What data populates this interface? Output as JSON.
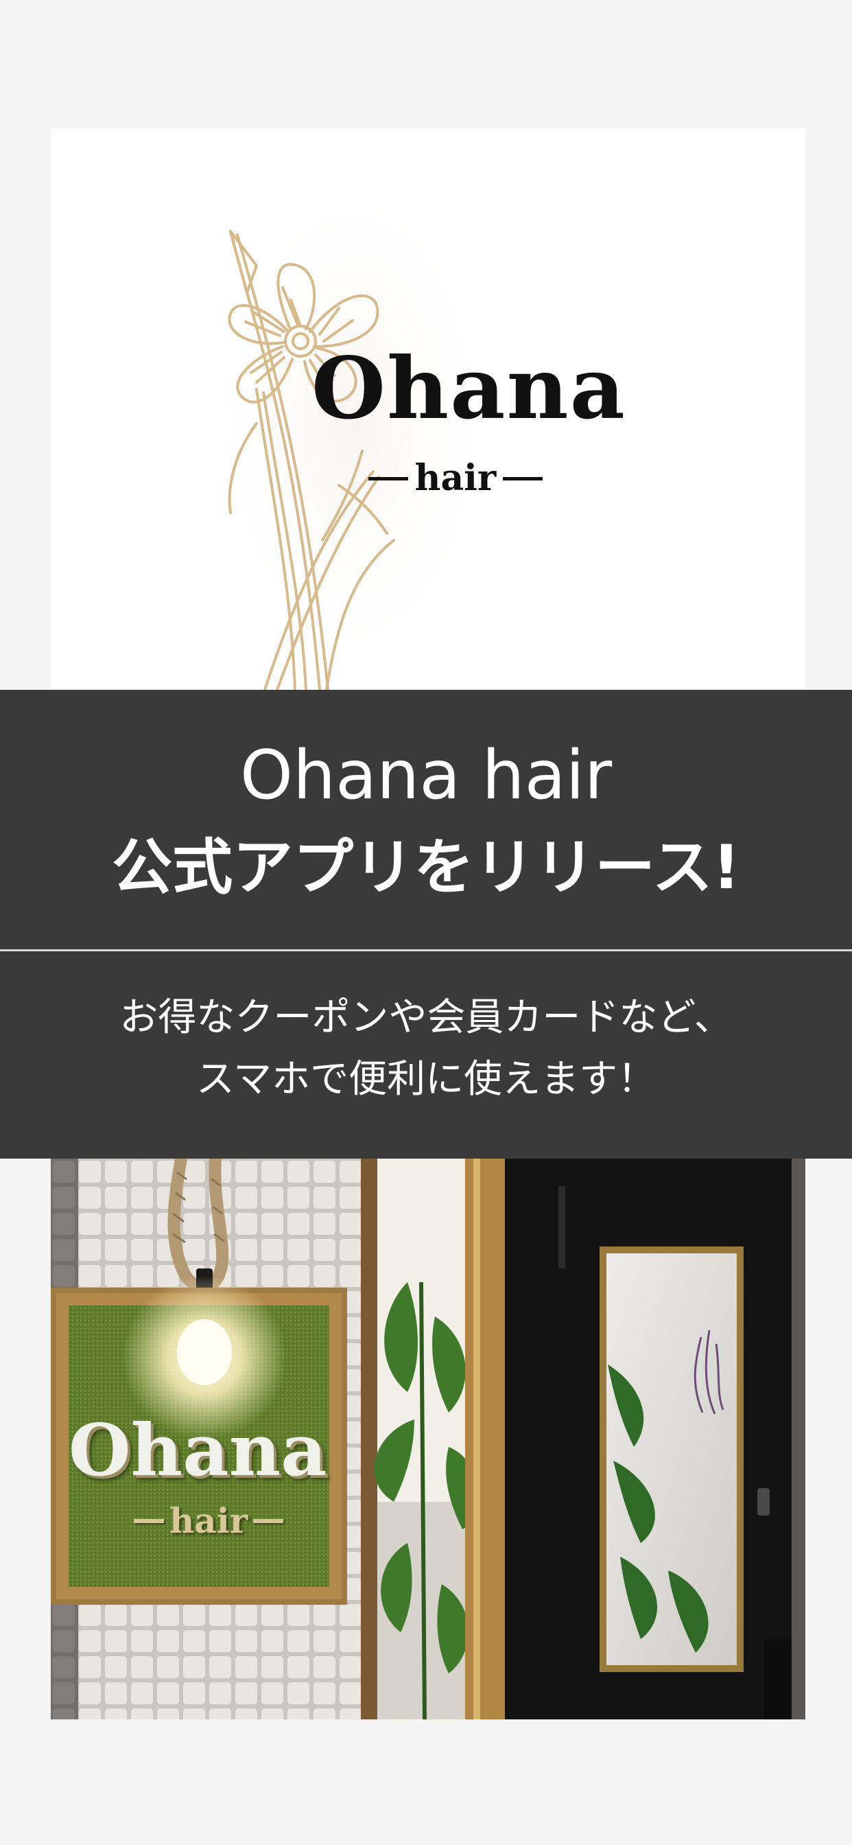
{
  "logo": {
    "name": "Ohana",
    "sub": "hair"
  },
  "headline": {
    "line1": "Ohana hair",
    "line2": "公式アプリをリリース!"
  },
  "subtext": {
    "line1": "お得なクーポンや会員カードなど、",
    "line2": "スマホで便利に使えます！"
  },
  "storefront_sign": {
    "name": "Ohana",
    "sub": "hair"
  },
  "colors": {
    "background": "#f4f4f4",
    "band": "#3a3a3a",
    "divider": "#d9d9d9",
    "flower_line": "#d8b98a",
    "sign_green": "#5f7d2c",
    "sign_frame": "#a07a40"
  },
  "icons": {
    "flower": "daffodil-illustration"
  }
}
